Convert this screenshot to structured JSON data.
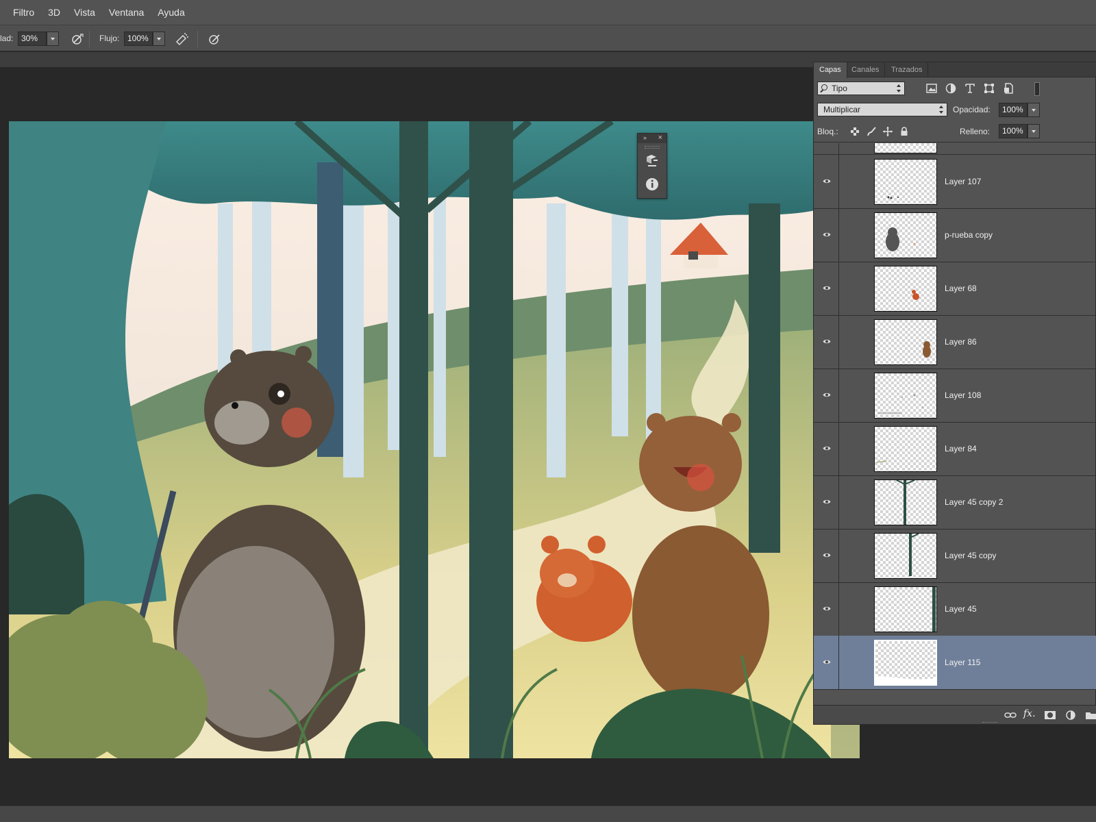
{
  "menu": {
    "items": [
      "Filtro",
      "3D",
      "Vista",
      "Ventana",
      "Ayuda"
    ]
  },
  "options_bar": {
    "opacity_label_partial": "lad:",
    "opacity_value": "30%",
    "flow_label": "Flujo:",
    "flow_value": "100%",
    "icons": [
      "pressure-opacity-icon",
      "airbrush-icon",
      "pressure-size-icon"
    ]
  },
  "floating_panel": {
    "collapse_glyph": "»",
    "close_glyph": "×",
    "icons": [
      "3d-properties-icon",
      "info-icon"
    ]
  },
  "layers_panel": {
    "tabs": [
      "Capas",
      "Canales",
      "Trazados"
    ],
    "active_tab": "Capas",
    "filter_kind": "Tipo",
    "filter_icons": [
      "pixel-layer-filter-icon",
      "adjustment-layer-filter-icon",
      "type-layer-filter-icon",
      "shape-layer-filter-icon",
      "smart-object-filter-icon"
    ],
    "blend_mode": "Multiplicar",
    "opacity_label": "Opacidad:",
    "opacity_value": "100%",
    "lock_label": "Bloq.:",
    "lock_icons": [
      "lock-transparent-pixels-icon",
      "lock-image-pixels-icon",
      "lock-position-icon",
      "lock-all-icon"
    ],
    "fill_label": "Relleno:",
    "fill_value": "100%",
    "layers": [
      {
        "name": "Layer 107",
        "visible": true,
        "selected": false
      },
      {
        "name": "p-rueba copy",
        "visible": true,
        "selected": false
      },
      {
        "name": "Layer 68",
        "visible": true,
        "selected": false
      },
      {
        "name": "Layer 86",
        "visible": true,
        "selected": false
      },
      {
        "name": "Layer 108",
        "visible": true,
        "selected": false
      },
      {
        "name": "Layer 84",
        "visible": true,
        "selected": false
      },
      {
        "name": "Layer 45 copy 2",
        "visible": true,
        "selected": false
      },
      {
        "name": "Layer 45 copy",
        "visible": true,
        "selected": false
      },
      {
        "name": "Layer 45",
        "visible": true,
        "selected": false
      },
      {
        "name": "Layer 115",
        "visible": true,
        "selected": true
      }
    ],
    "footer_icons": [
      "link-layers-icon",
      "fx-icon",
      "add-mask-icon",
      "new-adjustment-icon",
      "new-group-icon"
    ],
    "fx_glyph": "fx."
  },
  "colors": {
    "selection": "#6f7f99",
    "panel_bg": "#535353",
    "canvas_bg": "#282828"
  }
}
